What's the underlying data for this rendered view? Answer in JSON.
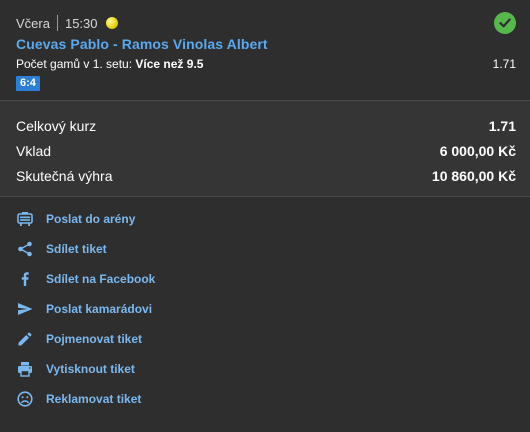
{
  "bet": {
    "date": "Včera",
    "time": "15:30",
    "sport_icon": "tennis-ball-icon",
    "status_icon": "check-circle-icon",
    "match": "Cuevas Pablo - Ramos Vinolas Albert",
    "market_label": "Počet gamů v 1. setu:",
    "market_pick": "Více než 9.5",
    "odd": "1.71",
    "result": "6:4"
  },
  "summary": {
    "total_odds_label": "Celkový kurz",
    "total_odds_value": "1.71",
    "stake_label": "Vklad",
    "stake_value": "6 000,00 Kč",
    "win_label": "Skutečná výhra",
    "win_value": "10 860,00 Kč"
  },
  "actions": [
    {
      "label": "Poslat do arény",
      "icon": "arena-icon"
    },
    {
      "label": "Sdílet tiket",
      "icon": "share-icon"
    },
    {
      "label": "Sdílet na Facebook",
      "icon": "facebook-icon"
    },
    {
      "label": "Poslat kamarádovi",
      "icon": "send-icon"
    },
    {
      "label": "Pojmenovat tiket",
      "icon": "pencil-icon"
    },
    {
      "label": "Vytisknout tiket",
      "icon": "printer-icon"
    },
    {
      "label": "Reklamovat tiket",
      "icon": "sad-face-icon"
    }
  ],
  "colors": {
    "background": "#2e2e2e",
    "summary_background": "#353535",
    "link": "#7ab8ef",
    "match_title": "#5aa9ee",
    "success": "#57b74d",
    "score_badge": "#2b7fd4"
  }
}
